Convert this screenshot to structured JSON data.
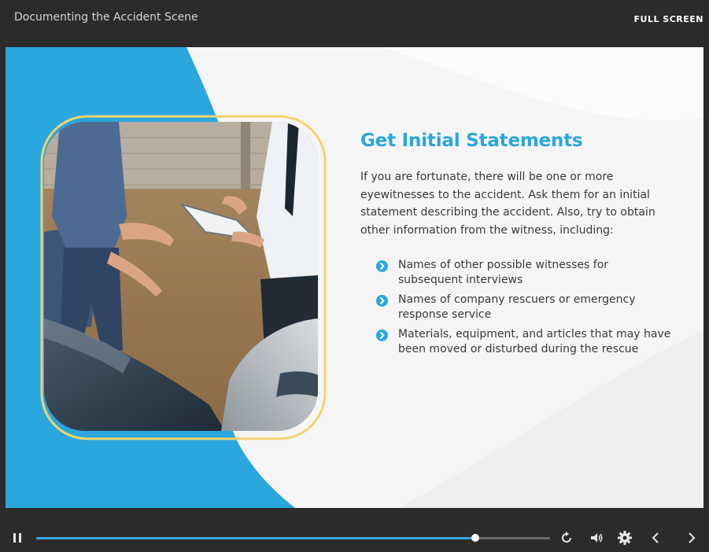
{
  "player": {
    "course_title": "Documenting the Accident Scene",
    "fullscreen_label": "FULL SCREEN",
    "progress": 0.855
  },
  "slide": {
    "heading": "Get Initial Statements",
    "intro": "If you are fortunate, there will be one or more eyewitnesses to the accident. Ask them for an initial statement describing the accident. Also, try to obtain other information from the witness, including:",
    "bullets": [
      "Names of other possible witnesses for subsequent interviews",
      "Names of company rescuers or emergency response service",
      "Materials, equipment, and articles that may have been moved or disturbed during the rescue"
    ]
  },
  "colors": {
    "accent_blue": "#2aa7dd",
    "frame_yellow": "#f2d36b",
    "bar_dark": "#2b2b2b"
  },
  "icons": {
    "pause": "pause-icon",
    "replay": "replay-icon",
    "volume": "volume-icon",
    "settings": "gear-icon",
    "prev": "chevron-left-icon",
    "next": "chevron-right-icon",
    "bullet": "chevron-circle-icon"
  }
}
